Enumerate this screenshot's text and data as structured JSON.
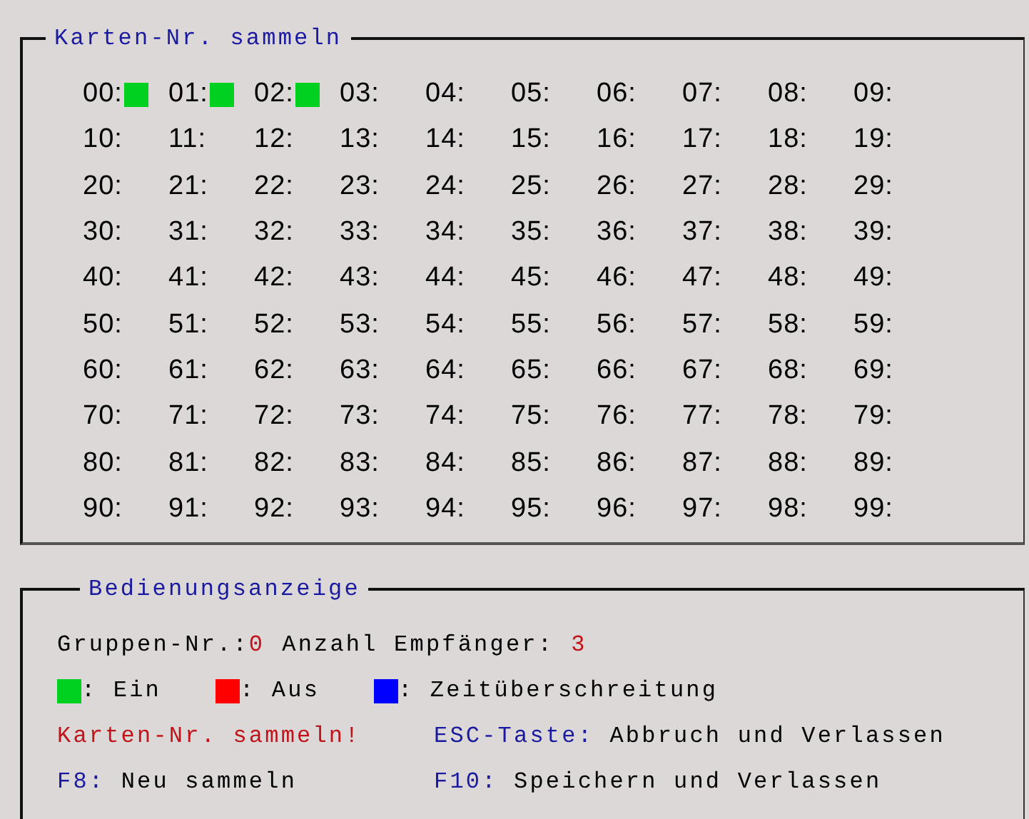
{
  "card_group": {
    "title": "Karten-Nr. sammeln",
    "cards": [
      {
        "label": "00:",
        "color": "#00d020"
      },
      {
        "label": "01:",
        "color": "#00d020"
      },
      {
        "label": "02:",
        "color": "#00d020"
      },
      {
        "label": "03:"
      },
      {
        "label": "04:"
      },
      {
        "label": "05:"
      },
      {
        "label": "06:"
      },
      {
        "label": "07:"
      },
      {
        "label": "08:"
      },
      {
        "label": "09:"
      },
      {
        "label": "10:"
      },
      {
        "label": "11:"
      },
      {
        "label": "12:"
      },
      {
        "label": "13:"
      },
      {
        "label": "14:"
      },
      {
        "label": "15:"
      },
      {
        "label": "16:"
      },
      {
        "label": "17:"
      },
      {
        "label": "18:"
      },
      {
        "label": "19:"
      },
      {
        "label": "20:"
      },
      {
        "label": "21:"
      },
      {
        "label": "22:"
      },
      {
        "label": "23:"
      },
      {
        "label": "24:"
      },
      {
        "label": "25:"
      },
      {
        "label": "26:"
      },
      {
        "label": "27:"
      },
      {
        "label": "28:"
      },
      {
        "label": "29:"
      },
      {
        "label": "30:"
      },
      {
        "label": "31:"
      },
      {
        "label": "32:"
      },
      {
        "label": "33:"
      },
      {
        "label": "34:"
      },
      {
        "label": "35:"
      },
      {
        "label": "36:"
      },
      {
        "label": "37:"
      },
      {
        "label": "38:"
      },
      {
        "label": "39:"
      },
      {
        "label": "40:"
      },
      {
        "label": "41:"
      },
      {
        "label": "42:"
      },
      {
        "label": "43:"
      },
      {
        "label": "44:"
      },
      {
        "label": "45:"
      },
      {
        "label": "46:"
      },
      {
        "label": "47:"
      },
      {
        "label": "48:"
      },
      {
        "label": "49:"
      },
      {
        "label": "50:"
      },
      {
        "label": "51:"
      },
      {
        "label": "52:"
      },
      {
        "label": "53:"
      },
      {
        "label": "54:"
      },
      {
        "label": "55:"
      },
      {
        "label": "56:"
      },
      {
        "label": "57:"
      },
      {
        "label": "58:"
      },
      {
        "label": "59:"
      },
      {
        "label": "60:"
      },
      {
        "label": "61:"
      },
      {
        "label": "62:"
      },
      {
        "label": "63:"
      },
      {
        "label": "64:"
      },
      {
        "label": "65:"
      },
      {
        "label": "66:"
      },
      {
        "label": "67:"
      },
      {
        "label": "68:"
      },
      {
        "label": "69:"
      },
      {
        "label": "70:"
      },
      {
        "label": "71:"
      },
      {
        "label": "72:"
      },
      {
        "label": "73:"
      },
      {
        "label": "74:"
      },
      {
        "label": "75:"
      },
      {
        "label": "76:"
      },
      {
        "label": "77:"
      },
      {
        "label": "78:"
      },
      {
        "label": "79:"
      },
      {
        "label": "80:"
      },
      {
        "label": "81:"
      },
      {
        "label": "82:"
      },
      {
        "label": "83:"
      },
      {
        "label": "84:"
      },
      {
        "label": "85:"
      },
      {
        "label": "86:"
      },
      {
        "label": "87:"
      },
      {
        "label": "88:"
      },
      {
        "label": "89:"
      },
      {
        "label": "90:"
      },
      {
        "label": "91:"
      },
      {
        "label": "92:"
      },
      {
        "label": "93:"
      },
      {
        "label": "94:"
      },
      {
        "label": "95:"
      },
      {
        "label": "96:"
      },
      {
        "label": "97:"
      },
      {
        "label": "98:"
      },
      {
        "label": "99:"
      }
    ]
  },
  "status_group": {
    "title": "Bedienungsanzeige",
    "group_label": "Gruppen-Nr.:",
    "group_value": "0",
    "receivers_label": "Anzahl Empfänger:",
    "receivers_value": "3",
    "legend": [
      {
        "color": "#00d020",
        "label": ": Ein"
      },
      {
        "color": "#ff0000",
        "label": ": Aus"
      },
      {
        "color": "#0000ff",
        "label": ": Zeitüberschreitung"
      }
    ],
    "message": "Karten-Nr. sammeln!",
    "keys": [
      {
        "key": "ESC-Taste:",
        "action": "Abbruch und Verlassen"
      },
      {
        "key": "F8:",
        "action": "Neu sammeln"
      },
      {
        "key": "F10:",
        "action": "Speichern und Verlassen"
      }
    ]
  }
}
